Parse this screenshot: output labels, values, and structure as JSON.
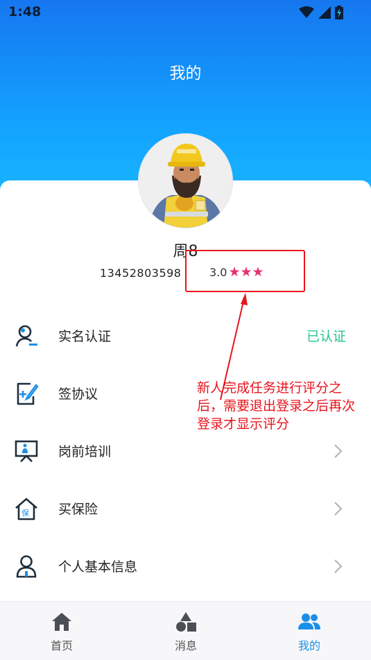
{
  "status_bar": {
    "time": "1:48"
  },
  "header": {
    "title": "我的"
  },
  "profile": {
    "name": "周8",
    "phone": "13452803598",
    "rating_value": "3.0",
    "stars": [
      "★",
      "★",
      "★"
    ]
  },
  "menu": [
    {
      "label": "实名认证",
      "status": "已认证",
      "icon": "user-verify-icon"
    },
    {
      "label": "签协议",
      "icon": "sign-document-icon"
    },
    {
      "label": "岗前培训",
      "icon": "training-board-icon"
    },
    {
      "label": "买保险",
      "icon": "insurance-house-icon"
    },
    {
      "label": "个人基本信息",
      "icon": "person-info-icon"
    }
  ],
  "annotation": {
    "text": "新人完成任务进行评分之后，需要退出登录之后再次登录才显示评分"
  },
  "tabbar": {
    "tabs": [
      {
        "label": "首页",
        "icon": "home-icon"
      },
      {
        "label": "消息",
        "icon": "shapes-icon"
      },
      {
        "label": "我的",
        "icon": "people-icon"
      }
    ],
    "active_index": 2
  },
  "colors": {
    "accent": "#1a8fe8",
    "verified": "#27c58a",
    "star": "#e8336b",
    "annotation": "#e8141c"
  }
}
